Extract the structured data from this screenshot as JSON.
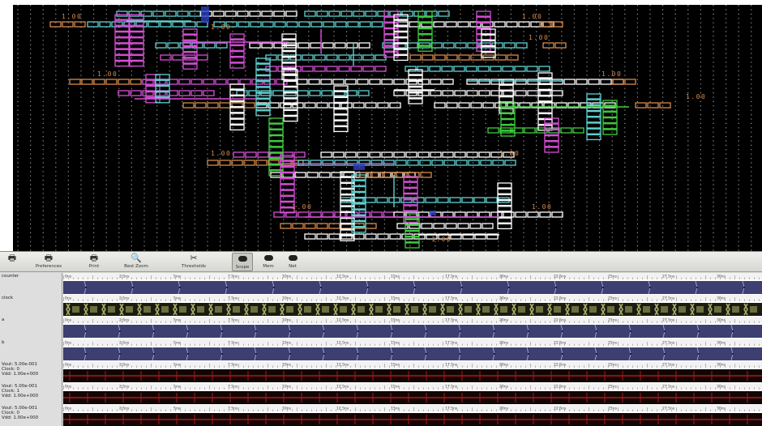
{
  "toolbar": {
    "buttons": [
      {
        "name": "print",
        "label": "",
        "icon": "printer-icon"
      },
      {
        "name": "preferences",
        "label": "Preferences",
        "icon": "printer-icon"
      },
      {
        "name": "print",
        "label": "Print",
        "icon": "printer-icon"
      },
      {
        "name": "zoom",
        "label": "Best Zoom",
        "icon": "magnifier-icon"
      },
      {
        "name": "tools",
        "label": "Thresholds",
        "icon": "scissors-icon"
      },
      {
        "name": "scope",
        "label": "Scope",
        "icon": "oval-icon"
      },
      {
        "name": "mem",
        "label": "Mem",
        "icon": "oval-icon"
      },
      {
        "name": "net",
        "label": "Net",
        "icon": "oval-icon"
      }
    ]
  },
  "schematic": {
    "value_labels": [
      "1.00",
      "1.00",
      "1.00",
      "1.00",
      "1.00",
      "1.00",
      "1.00",
      "1.00",
      "1.00",
      "1.00",
      "1.00",
      "1.00"
    ],
    "colors": {
      "background": "#000000",
      "dots": "#9a9a9a",
      "white": "#ffffff",
      "magenta": "#d94fd9",
      "cyan": "#5fd3d3",
      "green": "#3fcf3f",
      "orange": "#d88a4a",
      "blue": "#2b3fbf",
      "red": "#c02020"
    }
  },
  "waveform": {
    "ruler_labels": [
      "0ns",
      "2.5ns",
      "5ns",
      "7.5ns",
      "10ns",
      "12.5ns",
      "15ns",
      "17.5ns",
      "20ns",
      "22.5ns",
      "25ns",
      "27.5ns",
      "30ns"
    ],
    "rows": [
      {
        "label": "counter",
        "kind": "bus",
        "color": "#3c3f6f"
      },
      {
        "label": "clock",
        "kind": "clock",
        "color": "#a8ad68"
      },
      {
        "label": "a",
        "kind": "bus",
        "color": "#3c3f6f"
      },
      {
        "label": "b",
        "kind": "bus",
        "color": "#3c3f6f"
      },
      {
        "label": "Vout: 5.00e-001\nClock: 0\nVdd: 1.00e+000",
        "kind": "analog",
        "color": "#b01818"
      },
      {
        "label": "Vout: 5.00e-001\nClock: 1\nVdd: 1.00e+000",
        "kind": "analog",
        "color": "#b01818"
      },
      {
        "label": "Vout: 5.00e-001\nClock: 0\nVdd: 1.00e+000",
        "kind": "analog",
        "color": "#b01818"
      }
    ]
  }
}
